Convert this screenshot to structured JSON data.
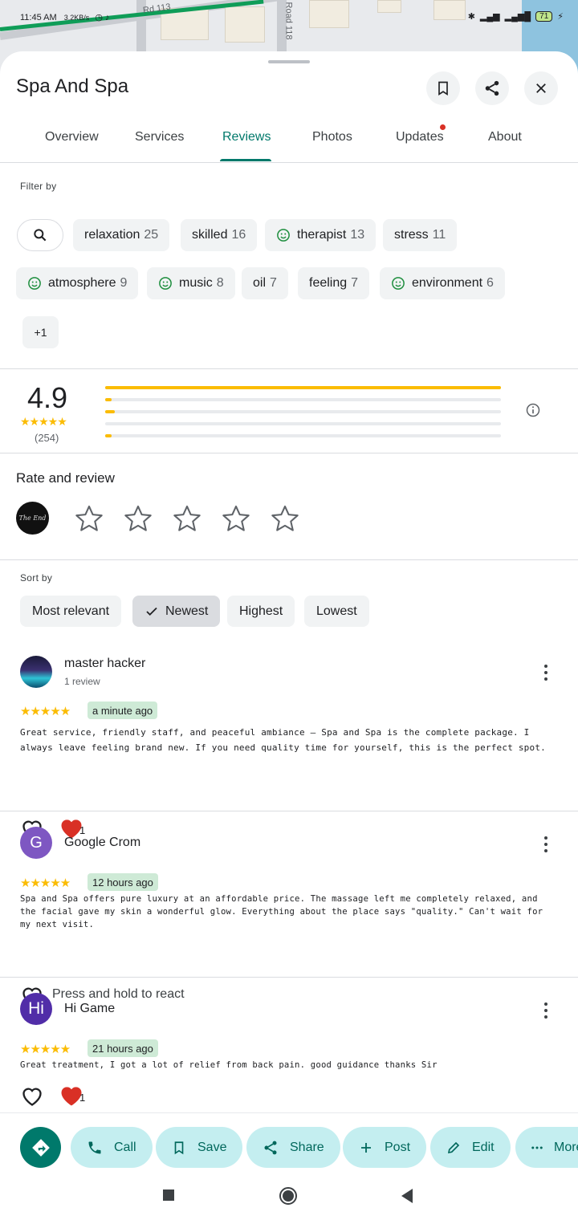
{
  "status_bar": {
    "time": "11:45 AM",
    "speed": "3.2KB/s",
    "battery": "71"
  },
  "map": {
    "road_labels": [
      "Rd 113",
      "Road 118"
    ]
  },
  "place": {
    "name": "Spa And Spa"
  },
  "tabs": [
    {
      "label": "Overview"
    },
    {
      "label": "Services"
    },
    {
      "label": "Reviews"
    },
    {
      "label": "Photos"
    },
    {
      "label": "Updates"
    },
    {
      "label": "About"
    }
  ],
  "filter": {
    "label": "Filter by",
    "chips": [
      {
        "label": "relaxation",
        "count": "25",
        "smile": false
      },
      {
        "label": "skilled",
        "count": "16",
        "smile": false
      },
      {
        "label": "therapist",
        "count": "13",
        "smile": true
      },
      {
        "label": "stress",
        "count": "11",
        "smile": false
      },
      {
        "label": "atmosphere",
        "count": "9",
        "smile": true
      },
      {
        "label": "music",
        "count": "8",
        "smile": true
      },
      {
        "label": "oil",
        "count": "7",
        "smile": false
      },
      {
        "label": "feeling",
        "count": "7",
        "smile": false
      },
      {
        "label": "environment",
        "count": "6",
        "smile": true
      }
    ],
    "more_label": "+1"
  },
  "summary": {
    "rating": "4.9",
    "stars": "★★★★★",
    "count": "(254)",
    "distribution": [
      {
        "stars": 5,
        "fraction": 1.0
      },
      {
        "stars": 4,
        "fraction": 0.015
      },
      {
        "stars": 3,
        "fraction": 0.025
      },
      {
        "stars": 2,
        "fraction": 0.0
      },
      {
        "stars": 1,
        "fraction": 0.015
      }
    ]
  },
  "rate_review": {
    "title": "Rate and review",
    "avatar_text": "The End"
  },
  "sort": {
    "label": "Sort by",
    "options": [
      {
        "label": "Most relevant",
        "selected": false
      },
      {
        "label": "Newest",
        "selected": true
      },
      {
        "label": "Highest",
        "selected": false
      },
      {
        "label": "Lowest",
        "selected": false
      }
    ]
  },
  "reviews": [
    {
      "name": "master hacker",
      "sub": "1 review",
      "stars": "★★★★★",
      "time": "a minute ago",
      "text": "Great service, friendly staff, and peaceful ambiance — Spa and Spa is the complete package. I always leave feeling brand new. If you need quality time for yourself, this is the perfect spot.",
      "reaction_count": "1"
    },
    {
      "name": "Google Crom",
      "initial": "G",
      "avatar_color": "#7e57c2",
      "stars": "★★★★★",
      "time": "12 hours ago",
      "text": "Spa and Spa offers pure luxury at an affordable price. The massage left me completely relaxed, and the facial gave my skin a wonderful glow. Everything about the place says \"quality.\" Can't wait for my next visit.",
      "press_text": "Press and hold to react"
    },
    {
      "name": "Hi Game",
      "initial": "Hi",
      "avatar_color": "#512da8",
      "stars": "★★★★★",
      "time": "21 hours ago",
      "text": "Great treatment, I got a lot of relief from back pain. good guidance thanks Sir",
      "reaction_count": "1"
    }
  ],
  "actions": [
    {
      "label": "Call",
      "icon": "phone-icon"
    },
    {
      "label": "Save",
      "icon": "bookmark-icon"
    },
    {
      "label": "Share",
      "icon": "share-icon"
    },
    {
      "label": "Post",
      "icon": "plus-icon"
    },
    {
      "label": "Edit",
      "icon": "pencil-icon"
    },
    {
      "label": "More",
      "icon": "more-horiz-icon"
    }
  ],
  "colors": {
    "accent": "#00796b",
    "star": "#fbbc04",
    "action_bg": "#c4eef0",
    "badge_bg": "#ceead6"
  }
}
